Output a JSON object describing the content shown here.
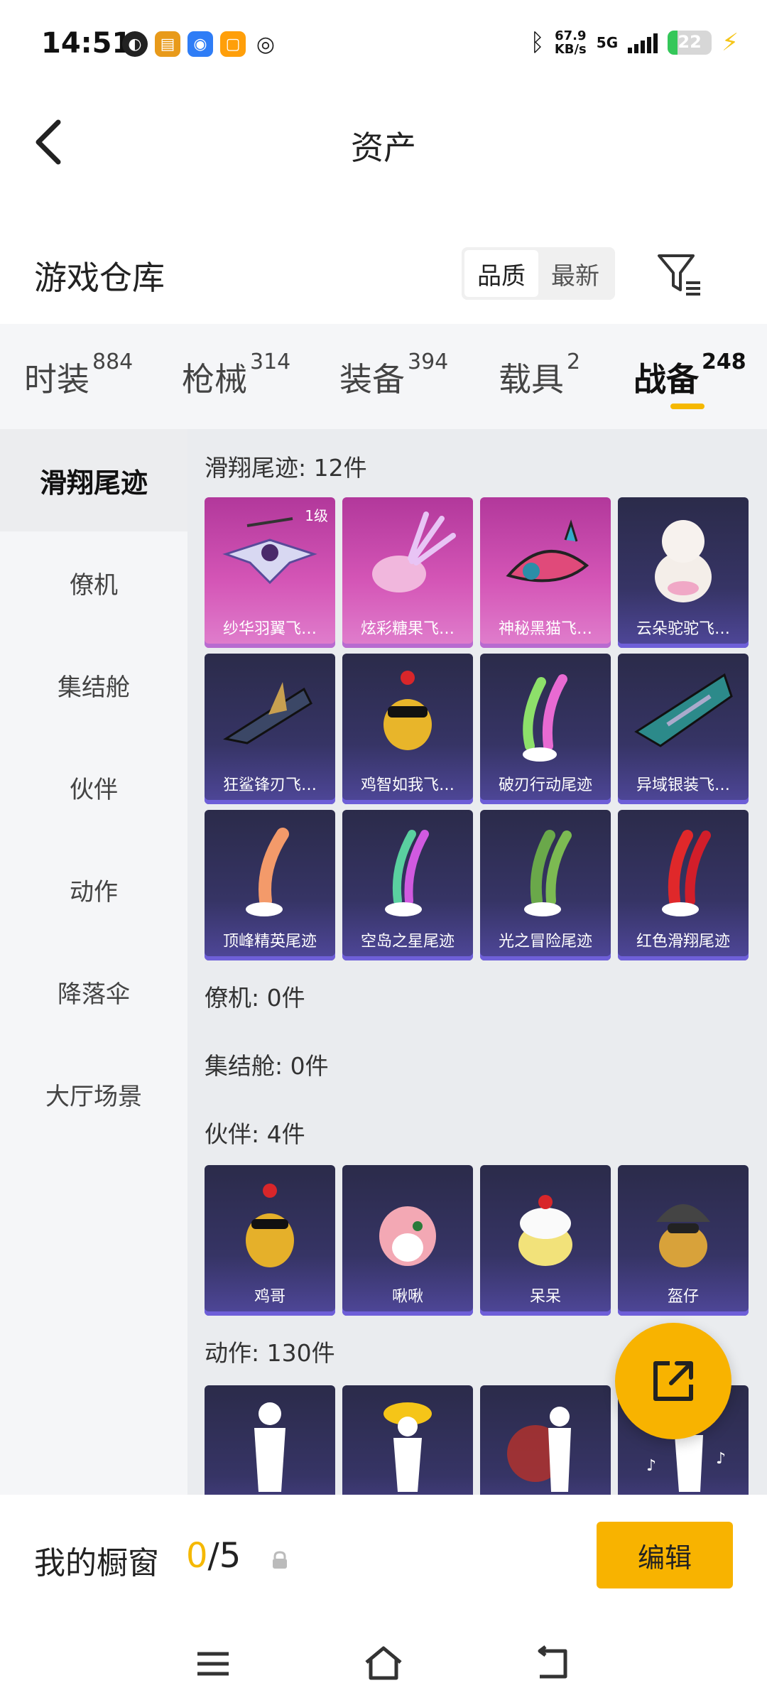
{
  "status_bar": {
    "time": "14:51",
    "net_speed_value": "67.9",
    "net_speed_unit": "KB/s",
    "network": "5G",
    "battery": "22",
    "notification_icons": [
      "game-app-icon",
      "game-promo-icon",
      "wireless-app-icon",
      "orange-app-icon",
      "netease-icon"
    ]
  },
  "header": {
    "title": "资产"
  },
  "warehouse": {
    "title": "游戏仓库",
    "sort_options": [
      "品质",
      "最新"
    ],
    "sort_selected": "品质"
  },
  "tabs": [
    {
      "label": "时装",
      "count": "884"
    },
    {
      "label": "枪械",
      "count": "314"
    },
    {
      "label": "装备",
      "count": "394"
    },
    {
      "label": "载具",
      "count": "2"
    },
    {
      "label": "战备",
      "count": "248",
      "active": true
    }
  ],
  "sidebar": {
    "items": [
      "滑翔尾迹",
      "僚机",
      "集结舱",
      "伙伴",
      "动作",
      "降落伞",
      "大厅场景"
    ],
    "active": "滑翔尾迹"
  },
  "sections": [
    {
      "title": "滑翔尾迹: 12件",
      "items": [
        {
          "name": "纱华羽翼飞…",
          "rarity": "pink",
          "level": "1级"
        },
        {
          "name": "炫彩糖果飞…",
          "rarity": "pink"
        },
        {
          "name": "神秘黑猫飞…",
          "rarity": "pink"
        },
        {
          "name": "云朵驼驼飞…",
          "rarity": "purple"
        },
        {
          "name": "狂鲨锋刃飞…",
          "rarity": "purple"
        },
        {
          "name": "鸡智如我飞…",
          "rarity": "purple"
        },
        {
          "name": "破刃行动尾迹",
          "rarity": "purple"
        },
        {
          "name": "异域银装飞…",
          "rarity": "purple"
        },
        {
          "name": "顶峰精英尾迹",
          "rarity": "purple"
        },
        {
          "name": "空岛之星尾迹",
          "rarity": "purple"
        },
        {
          "name": "光之冒险尾迹",
          "rarity": "purple"
        },
        {
          "name": "红色滑翔尾迹",
          "rarity": "purple"
        }
      ]
    },
    {
      "title": "僚机: 0件",
      "items": []
    },
    {
      "title": "集结舱: 0件",
      "items": []
    },
    {
      "title": "伙伴: 4件",
      "items": [
        {
          "name": "鸡哥",
          "rarity": "purple"
        },
        {
          "name": "啾啾",
          "rarity": "purple"
        },
        {
          "name": "呆呆",
          "rarity": "purple"
        },
        {
          "name": "盔仔",
          "rarity": "purple"
        }
      ]
    },
    {
      "title": "动作: 130件",
      "items": []
    }
  ],
  "showcase": {
    "label": "我的橱窗",
    "current": "0",
    "separator_total": "/5",
    "edit_label": "编辑"
  },
  "colors": {
    "accent": "#f8b300",
    "card_purple": "#363465",
    "card_pink": "#d455b6"
  }
}
